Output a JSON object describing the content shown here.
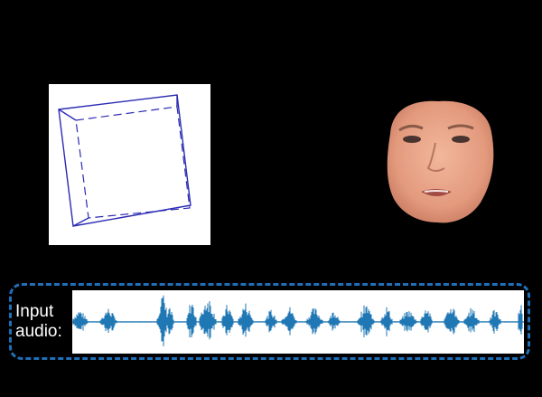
{
  "audio": {
    "label_line1": "Input",
    "label_line2": "audio:",
    "waveform_color": "#1f77b4",
    "frame_color": "#1f6fb8"
  },
  "pose_box": {
    "line_color": "#2b2bb5"
  },
  "colors": {
    "background": "#000000",
    "panel": "#ffffff"
  }
}
